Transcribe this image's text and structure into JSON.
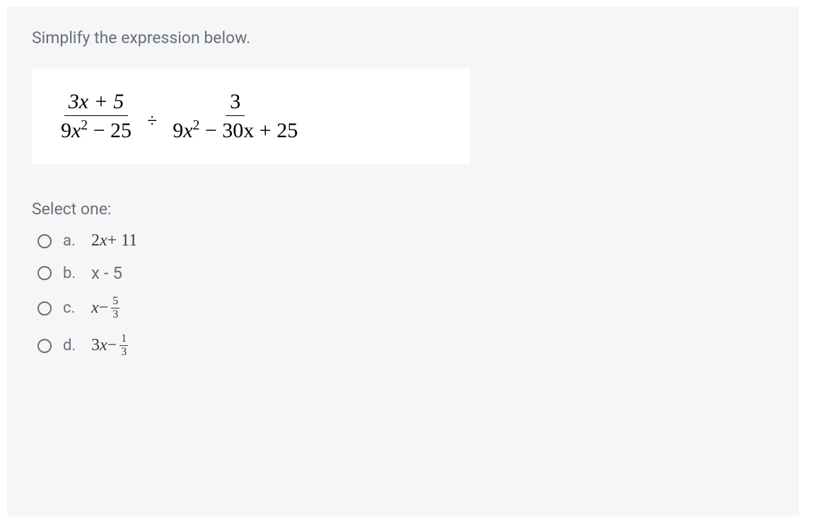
{
  "question": {
    "prompt": "Simplify the expression below.",
    "expression": {
      "left_fraction": {
        "numerator": "3x + 5",
        "denominator_pre": "9",
        "denominator_var": "x",
        "denominator_exp": "2",
        "denominator_post": " − 25"
      },
      "operator": "÷",
      "right_fraction": {
        "numerator": "3",
        "denominator_pre": "9",
        "denominator_var": "x",
        "denominator_exp": "2",
        "denominator_post": " − 30x + 25"
      }
    },
    "select_label": "Select one:",
    "options": {
      "a": {
        "letter": "a.",
        "pre": "2",
        "var": "x",
        "post": " + 11"
      },
      "b": {
        "letter": "b.",
        "text": "x - 5"
      },
      "c": {
        "letter": "c.",
        "var": "x",
        "op": " − ",
        "frac_num": "5",
        "frac_den": "3"
      },
      "d": {
        "letter": "d.",
        "pre": "3",
        "var": "x",
        "op": " − ",
        "frac_num": "1",
        "frac_den": "3"
      }
    }
  },
  "chart_data": {
    "type": "table",
    "title": "Multiple choice question: Simplify (3x+5)/(9x^2-25) ÷ 3/(9x^2-30x+25)",
    "options": [
      {
        "id": "a",
        "value": "2x + 11"
      },
      {
        "id": "b",
        "value": "x - 5"
      },
      {
        "id": "c",
        "value": "x - 5/3"
      },
      {
        "id": "d",
        "value": "3x - 1/3"
      }
    ]
  }
}
